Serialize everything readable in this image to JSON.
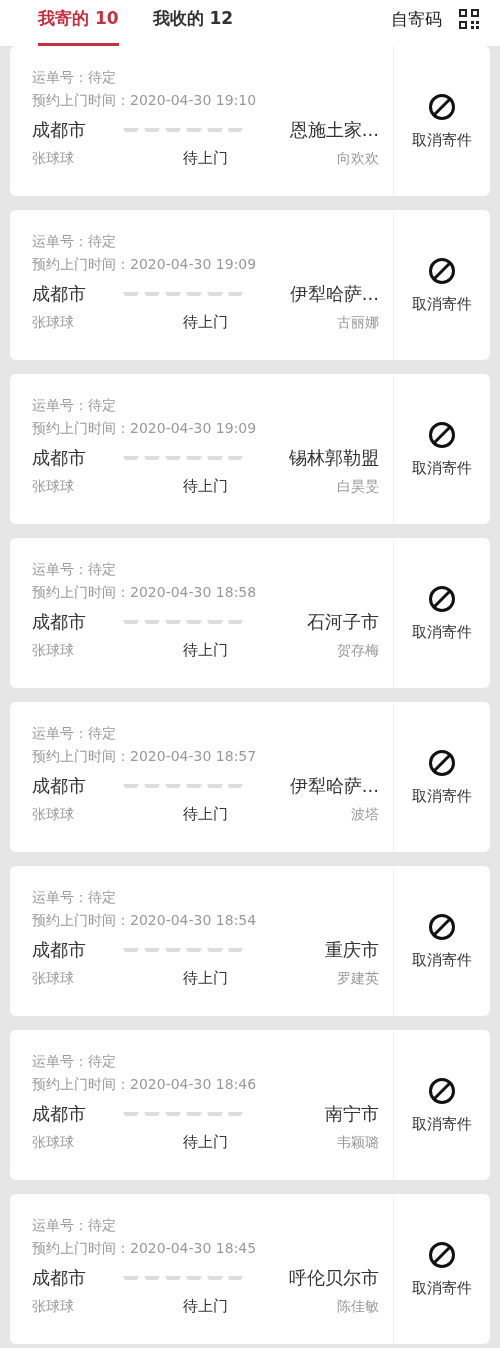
{
  "tabs": [
    {
      "label": "我寄的 10",
      "selected": true
    },
    {
      "label": "我收的 12",
      "selected": false
    }
  ],
  "self_send_code": {
    "label": "自寄码"
  },
  "orders": [
    {
      "waybill": "运单号：待定",
      "pickup_time": "预约上门时间：2020-04-30 19:10",
      "origin": "成都市",
      "destination": "恩施土家...",
      "sender": "张球球",
      "status": "待上门",
      "recipient": "向欢欢",
      "action": "取消寄件"
    },
    {
      "waybill": "运单号：待定",
      "pickup_time": "预约上门时间：2020-04-30 19:09",
      "origin": "成都市",
      "destination": "伊犁哈萨...",
      "sender": "张球球",
      "status": "待上门",
      "recipient": "古丽娜",
      "action": "取消寄件"
    },
    {
      "waybill": "运单号：待定",
      "pickup_time": "预约上门时间：2020-04-30 19:09",
      "origin": "成都市",
      "destination": "锡林郭勒盟",
      "sender": "张球球",
      "status": "待上门",
      "recipient": "白昊旻",
      "action": "取消寄件"
    },
    {
      "waybill": "运单号：待定",
      "pickup_time": "预约上门时间：2020-04-30 18:58",
      "origin": "成都市",
      "destination": "石河子市",
      "sender": "张球球",
      "status": "待上门",
      "recipient": "贺存梅",
      "action": "取消寄件"
    },
    {
      "waybill": "运单号：待定",
      "pickup_time": "预约上门时间：2020-04-30 18:57",
      "origin": "成都市",
      "destination": "伊犁哈萨...",
      "sender": "张球球",
      "status": "待上门",
      "recipient": "波塔",
      "action": "取消寄件"
    },
    {
      "waybill": "运单号：待定",
      "pickup_time": "预约上门时间：2020-04-30 18:54",
      "origin": "成都市",
      "destination": "重庆市",
      "sender": "张球球",
      "status": "待上门",
      "recipient": "罗建英",
      "action": "取消寄件"
    },
    {
      "waybill": "运单号：待定",
      "pickup_time": "预约上门时间：2020-04-30 18:46",
      "origin": "成都市",
      "destination": "南宁市",
      "sender": "张球球",
      "status": "待上门",
      "recipient": "韦颖璐",
      "action": "取消寄件"
    },
    {
      "waybill": "运单号：待定",
      "pickup_time": "预约上门时间：2020-04-30 18:45",
      "origin": "成都市",
      "destination": "呼伦贝尔市",
      "sender": "张球球",
      "status": "待上门",
      "recipient": "陈佳敏",
      "action": "取消寄件"
    }
  ]
}
